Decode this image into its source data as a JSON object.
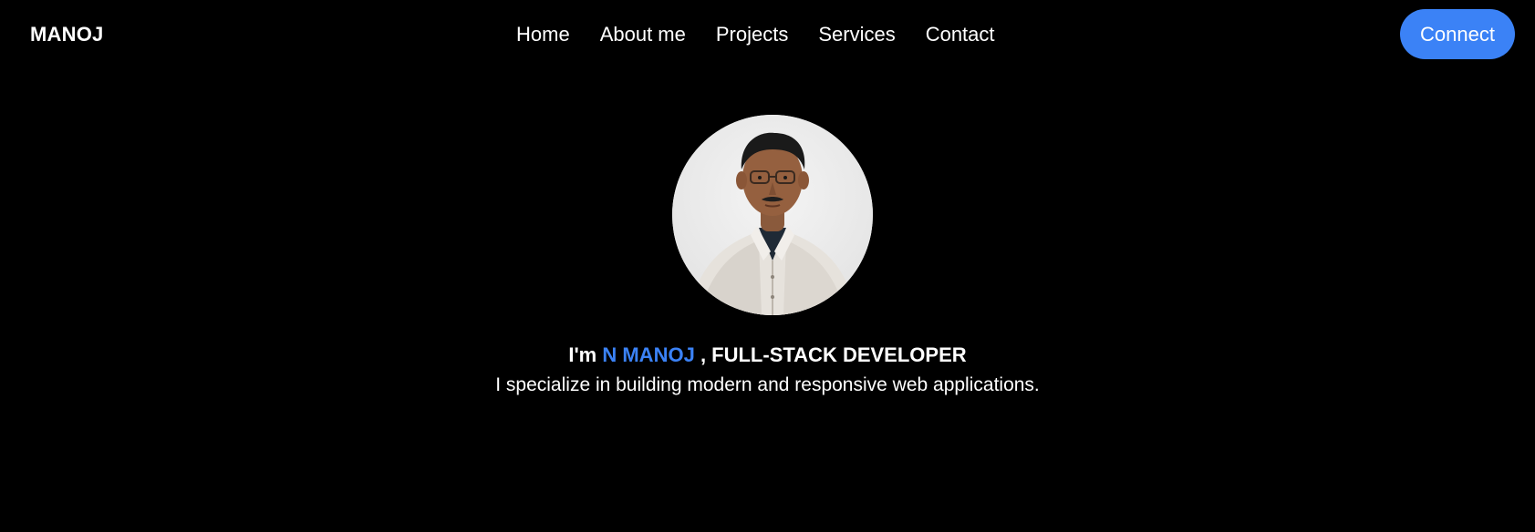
{
  "header": {
    "brand": "MANOJ",
    "nav": [
      {
        "label": "Home"
      },
      {
        "label": "About me"
      },
      {
        "label": "Projects"
      },
      {
        "label": "Services"
      },
      {
        "label": "Contact"
      }
    ],
    "connect_label": "Connect"
  },
  "hero": {
    "intro_prefix": "I'm",
    "name": "N MANOJ",
    "role": ", FULL-STACK DEVELOPER",
    "description": "I specialize in building modern and responsive web applications."
  },
  "colors": {
    "background": "#000000",
    "text": "#ffffff",
    "accent": "#3b82f6"
  }
}
